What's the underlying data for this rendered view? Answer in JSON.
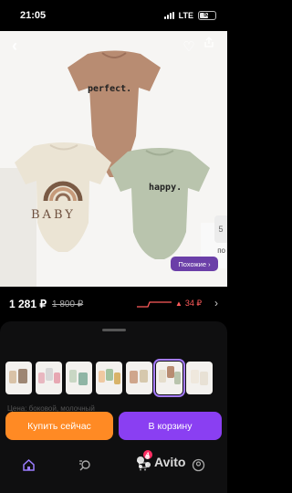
{
  "status_bar": {
    "time": "21:05",
    "network": "LTE",
    "battery": "52"
  },
  "photo": {
    "print_left": "BABY",
    "print_top": "perfect.",
    "print_right": "happy.",
    "similar_label": "Похожие ›",
    "side_badge_text": "5",
    "side_text": "по"
  },
  "price": {
    "current": "1 281 ₽",
    "old": "1 800 ₽",
    "delta": "34 ₽"
  },
  "description": "Цена: боковой, молочный",
  "buttons": {
    "buy_now": "Купить сейчас",
    "add_to_cart": "В корзину"
  },
  "cart_count": "4",
  "watermark": "Avito",
  "colors": {
    "buy": "#ff8a24",
    "cart": "#8a3ff2",
    "accent": "#a57bff",
    "delta": "#ff5b5b"
  },
  "icons": [
    "back-icon",
    "heart-icon",
    "share-icon",
    "home-icon",
    "search-icon",
    "cart-icon",
    "profile-icon"
  ]
}
